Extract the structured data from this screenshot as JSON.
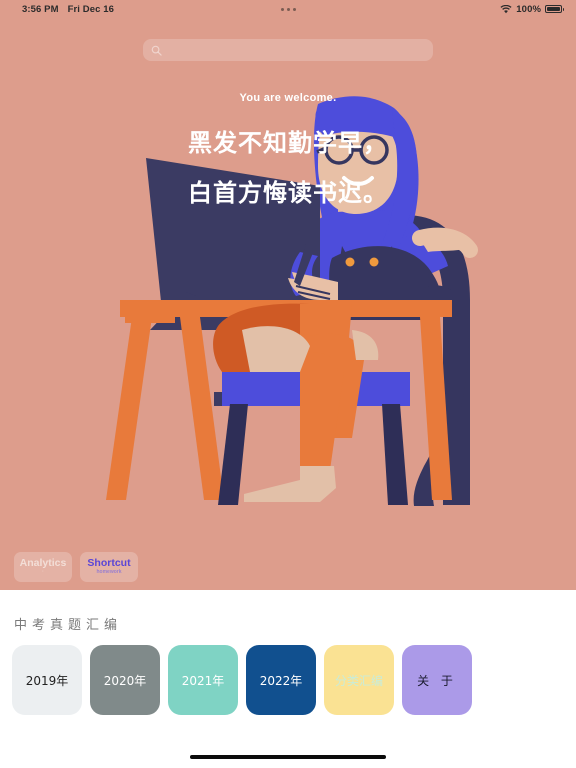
{
  "status_bar": {
    "time": "3:56 PM",
    "date": "Fri Dec 16",
    "battery_percent": "100%",
    "wifi_icon": "wifi-icon",
    "battery_icon": "battery-full-icon",
    "multitask_indicator": "three-dots-icon"
  },
  "search": {
    "icon": "search-icon",
    "placeholder": "",
    "value": ""
  },
  "hero": {
    "welcome_text": "You are welcome.",
    "poem_line1": "黑发不知勤学早，",
    "poem_line2": "白首方悔读书迟。",
    "background_color": "#dd9d8c",
    "illustration_name": "student-at-desk-with-cat-illustration"
  },
  "widgets": [
    {
      "title": "Analytics",
      "subtitle": "·",
      "text_color": "#f3ded7"
    },
    {
      "title": "Shortcut",
      "subtitle": "homework",
      "text_color": "#5b46d6"
    }
  ],
  "library": {
    "section_title": "中考真题汇编",
    "cards": [
      {
        "label": "2019年",
        "bg": "#eceff1",
        "fg": "#222222",
        "spaced": false
      },
      {
        "label": "2020年",
        "bg": "#808a8a",
        "fg": "#ffffff",
        "spaced": false
      },
      {
        "label": "2021年",
        "bg": "#7fd3c4",
        "fg": "#ffffff",
        "spaced": false
      },
      {
        "label": "2022年",
        "bg": "#11508f",
        "fg": "#ffffff",
        "spaced": false
      },
      {
        "label": "分类汇编",
        "bg": "#fae293",
        "fg": "#c9ecd8",
        "spaced": false
      },
      {
        "label": "关 于",
        "bg": "#ab9ae8",
        "fg": "#1a1a2e",
        "spaced": true
      }
    ]
  },
  "home_indicator": "home-indicator"
}
